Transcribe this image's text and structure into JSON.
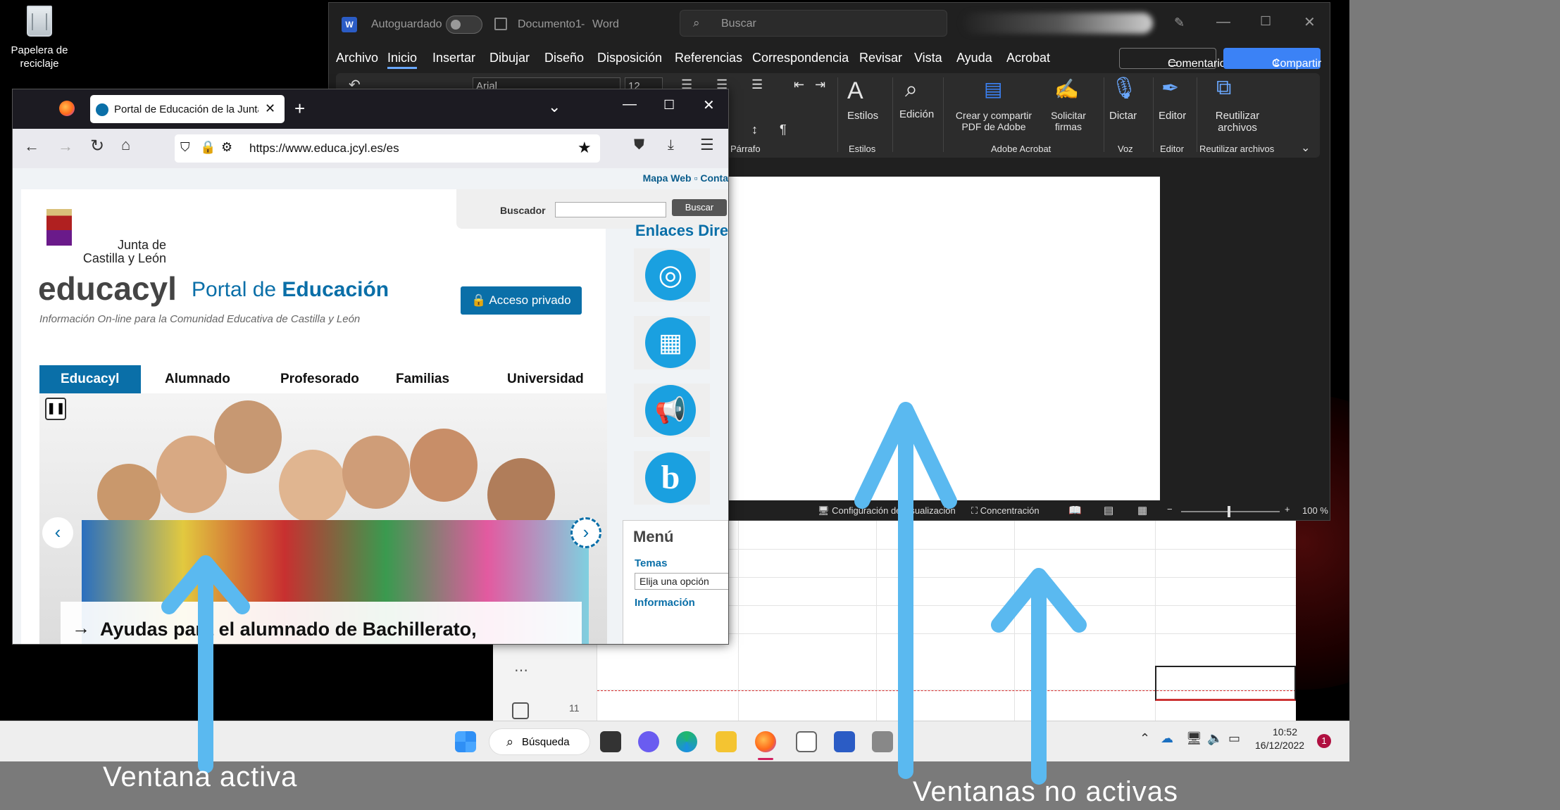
{
  "desktop": {
    "recycle_label": "Papelera de reciclaje"
  },
  "word": {
    "autosave": "Autoguardado",
    "doc_title": "Documento1",
    "app_name": "Word",
    "search_placeholder": "Buscar",
    "menu": [
      "Archivo",
      "Inicio",
      "Insertar",
      "Dibujar",
      "Diseño",
      "Disposición",
      "Referencias",
      "Correspondencia",
      "Revisar",
      "Vista",
      "Ayuda",
      "Acrobat"
    ],
    "comments_label": "Comentarios",
    "share_label": "Compartir",
    "font_name": "Arial",
    "font_size": "12",
    "ribbon": {
      "paragraph_group": "Párrafo",
      "styles": "Estilos",
      "styles_group": "Estilos",
      "editing": "Edición",
      "create_pdf_line1": "Crear y compartir",
      "create_pdf_line2": "PDF de Adobe",
      "request_sig_line1": "Solicitar",
      "request_sig_line2": "firmas",
      "acrobat_group": "Adobe Acrobat",
      "dictate": "Dictar",
      "voice_group": "Voz",
      "editor": "Editor",
      "editor_group": "Editor",
      "reuse_line1": "Reutilizar",
      "reuse_line2": "archivos",
      "reuse_group": "Reutilizar archivos"
    },
    "status": {
      "display_settings": "Configuración de visualización",
      "focus": "Concentración",
      "zoom": "100 %"
    }
  },
  "back_app": {
    "row_number": "11"
  },
  "firefox": {
    "tab_title": "Portal de Educación de la Junta",
    "url": "https://www.educa.jcyl.es/es",
    "page": {
      "top_links": [
        "Mapa Web",
        "Conta"
      ],
      "search_label": "Buscador",
      "search_button": "Buscar",
      "logo_line1": "Junta de",
      "logo_line2": "Castilla y León",
      "brand": "educacyl",
      "portal_word1": "Portal de",
      "portal_word2": "Educación",
      "tagline": "Información On-line para la Comunidad Educativa de Castilla y León",
      "private_access": "Acceso privado",
      "nav_tabs": [
        "Educacyl",
        "Alumnado",
        "Profesorado",
        "Familias",
        "Universidad"
      ],
      "slide_caption": "Ayudas para el alumnado de Bachillerato,",
      "direct_links_title": "Enlaces Dire",
      "menu_title": "Menú",
      "temas_label": "Temas",
      "temas_select": "Elija una opción",
      "info_label": "Información"
    }
  },
  "taskbar": {
    "search_label": "Búsqueda",
    "time": "10:52",
    "date": "16/12/2022",
    "notification_count": "1"
  },
  "annotations": {
    "active": "Ventana activa",
    "inactive": "Ventanas no activas"
  },
  "colors": {
    "arrow": "#5ab9f0",
    "brand_blue": "#0a6fa8",
    "word_accent": "#3b82f6"
  }
}
